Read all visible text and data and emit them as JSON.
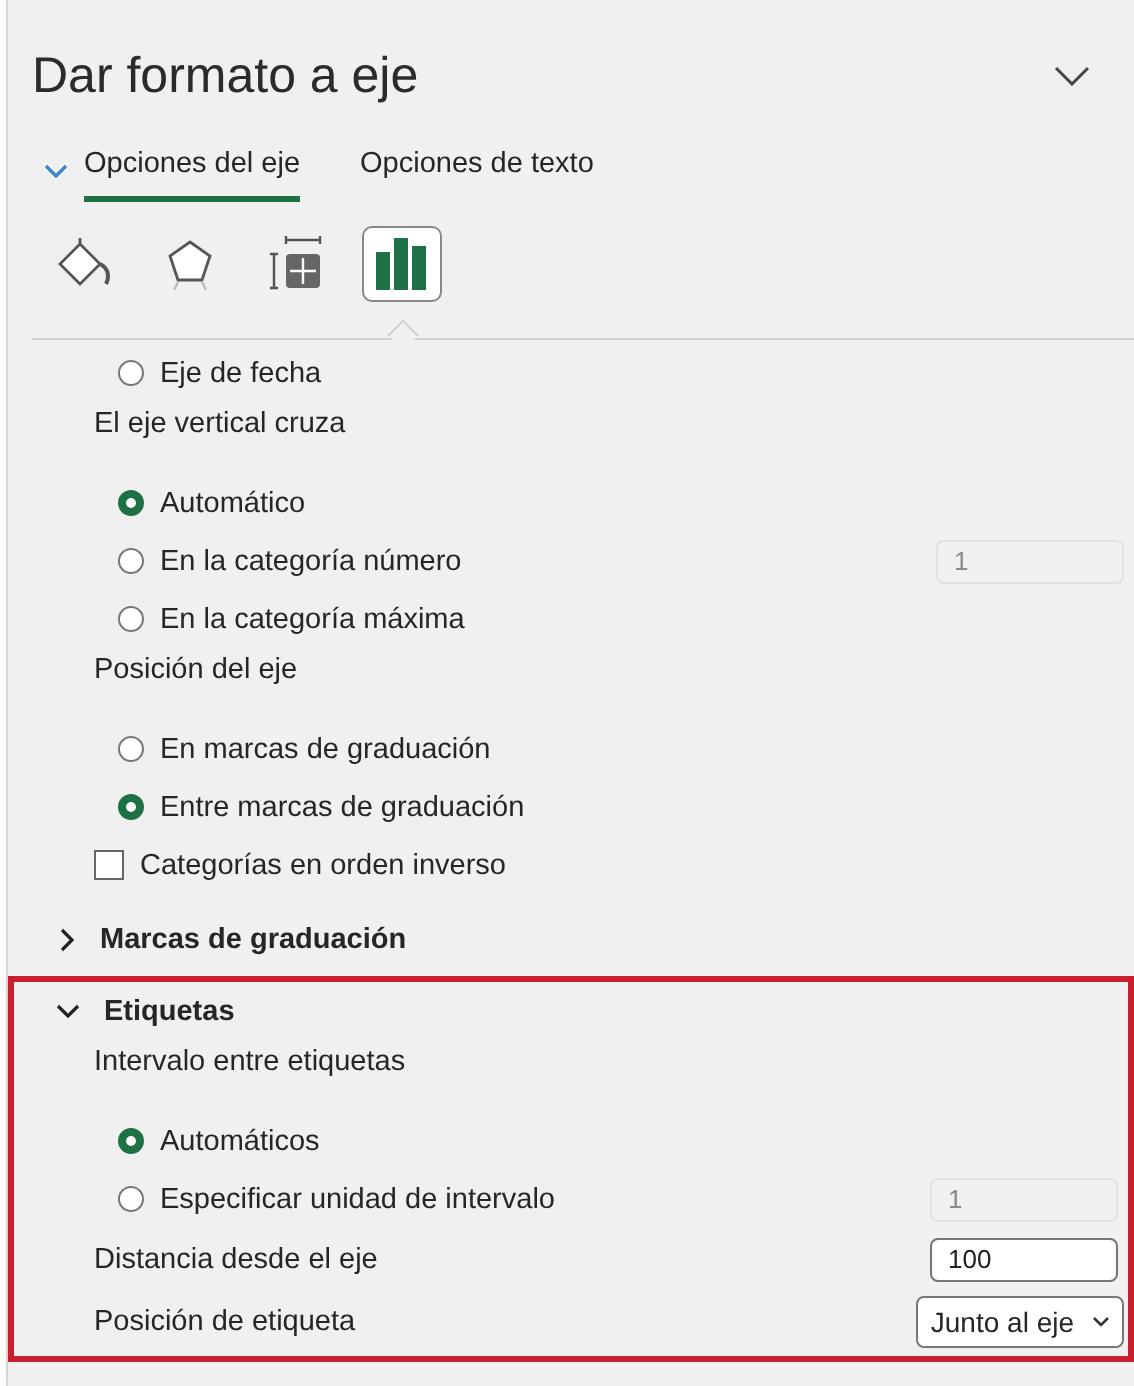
{
  "panel": {
    "title": "Dar formato a eje"
  },
  "tabs": [
    {
      "label": "Opciones del eje",
      "selected": true
    },
    {
      "label": "Opciones de texto",
      "selected": false
    }
  ],
  "icon_tabs": [
    {
      "kind": "fill",
      "selected": false
    },
    {
      "kind": "effects",
      "selected": false
    },
    {
      "kind": "size",
      "selected": false
    },
    {
      "kind": "axis",
      "selected": true
    }
  ],
  "items": [
    {
      "kind": "radio",
      "label": "Eje de fecha",
      "selected": false
    },
    {
      "kind": "label",
      "label": "El eje vertical cruza"
    },
    {
      "kind": "radio",
      "label": "Automático",
      "selected": true
    },
    {
      "kind": "radio",
      "label": "En la categoría número",
      "selected": false,
      "input": {
        "value": "1",
        "disabled": true
      }
    },
    {
      "kind": "radio",
      "label": "En la categoría máxima",
      "selected": false
    },
    {
      "kind": "label",
      "label": "Posición del eje"
    },
    {
      "kind": "radio",
      "label": "En marcas de graduación",
      "selected": false
    },
    {
      "kind": "radio",
      "label": "Entre marcas de graduación",
      "selected": true
    },
    {
      "kind": "checkbox",
      "label": "Categorías en orden inverso",
      "checked": false
    }
  ],
  "sections": [
    {
      "title": "Marcas de graduación",
      "expanded": false,
      "highlighted": false
    },
    {
      "title": "Etiquetas",
      "expanded": true,
      "highlighted": true,
      "items": [
        {
          "kind": "label",
          "label": "Intervalo entre etiquetas"
        },
        {
          "kind": "radio",
          "label": "Automáticos",
          "selected": true
        },
        {
          "kind": "radio",
          "label": "Especificar unidad de intervalo",
          "selected": false,
          "input": {
            "value": "1",
            "disabled": true
          }
        },
        {
          "kind": "input",
          "label": "Distancia desde el eje",
          "value": "100"
        },
        {
          "kind": "select",
          "label": "Posición de etiqueta",
          "value": "Junto al eje"
        }
      ]
    }
  ]
}
